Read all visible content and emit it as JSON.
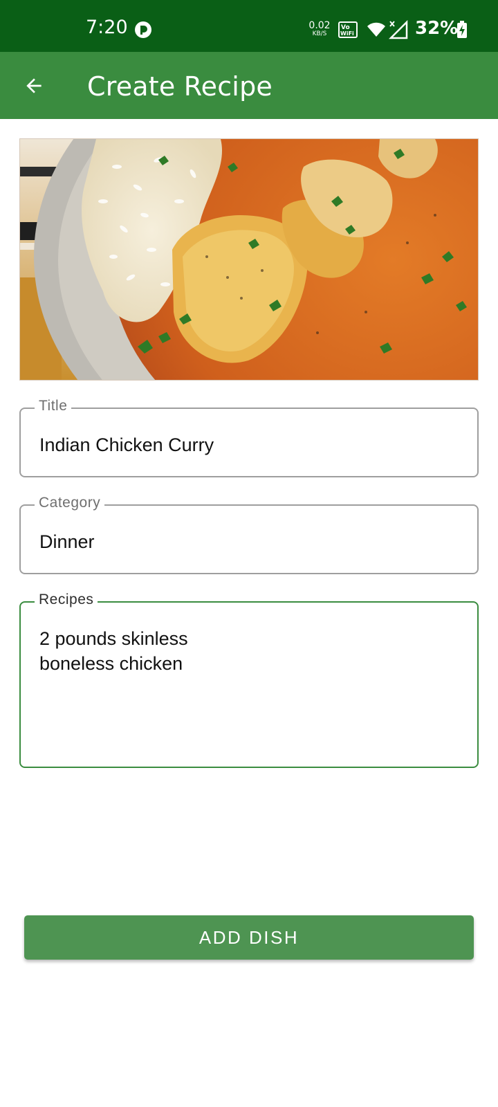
{
  "status_bar": {
    "time": "7:20",
    "net_speed_value": "0.02",
    "net_speed_unit": "KB/S",
    "vowifi_top": "Vo",
    "vowifi_bottom": "WiFi",
    "battery_percent": "32%",
    "icons": [
      "app-notification-icon",
      "vowifi-icon",
      "wifi-icon",
      "signal-icon",
      "battery-charging-icon"
    ]
  },
  "app_bar": {
    "title": "Create Recipe",
    "back_icon": "arrow-back-icon",
    "color": "#3a8c3f"
  },
  "image": {
    "description": "dish photo"
  },
  "form": {
    "title": {
      "label": "Title",
      "value": "Indian Chicken Curry"
    },
    "category": {
      "label": "Category",
      "value": "Dinner"
    },
    "recipes": {
      "label": "Recipes",
      "value": "2 pounds skinless\nboneless chicken"
    }
  },
  "actions": {
    "add_label": "ADD DISH",
    "button_color": "#4e9452"
  },
  "colors": {
    "status_bar": "#0a5f16",
    "focus": "#3a8c3f",
    "outline": "#9e9e9e"
  }
}
